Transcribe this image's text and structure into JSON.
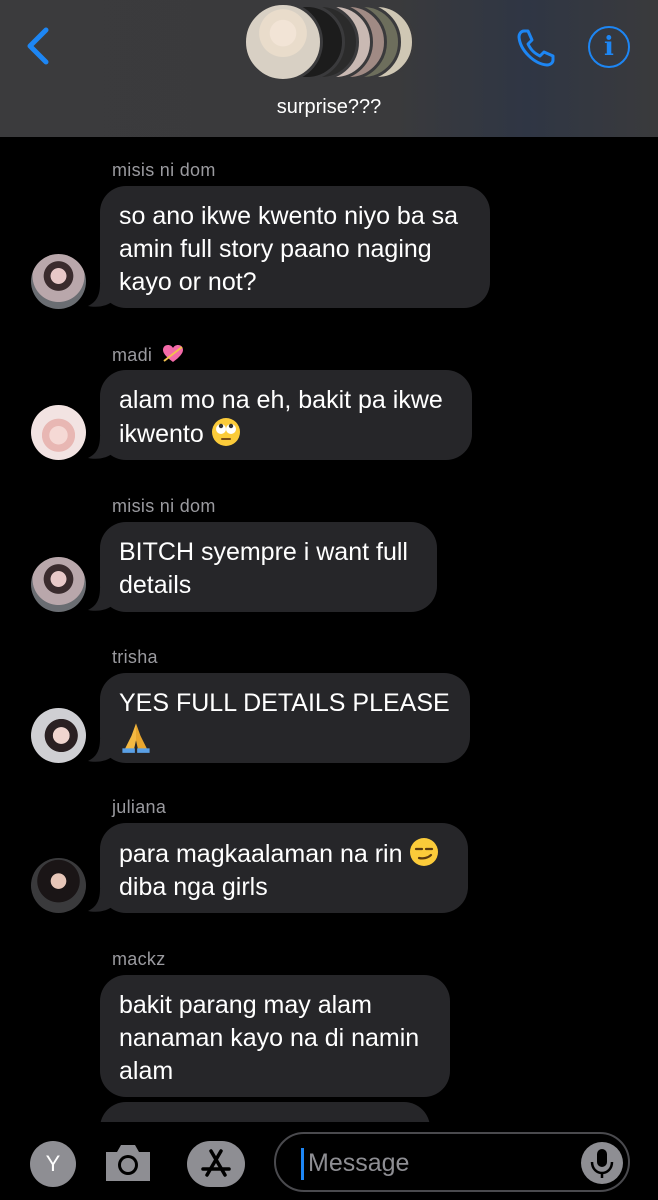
{
  "header": {
    "group_name": "surprise???",
    "accent": "#1d86f4"
  },
  "icons": {
    "back": "chevron-left-icon",
    "call": "phone-icon",
    "info": "info-icon",
    "camera": "camera-icon",
    "app_store": "app-store-icon",
    "mic": "microphone-icon"
  },
  "messages": [
    {
      "sender": "misis ni dom",
      "lines": [
        "so ano ikwe kwento niyo ba sa",
        "amin full story paano naging",
        "kayo or not?"
      ]
    },
    {
      "sender": "madi",
      "sender_emoji": "heart-with-arrow",
      "lines": [
        "alam mo na eh, bakit pa ikwe",
        "ikwento"
      ],
      "line_emoji": "face-with-rolling-eyes"
    },
    {
      "sender": "misis ni dom",
      "lines": [
        "BITCH syempre i want full",
        "details"
      ]
    },
    {
      "sender": "trisha",
      "lines": [
        "YES FULL DETAILS PLEASE"
      ],
      "line_emoji": "folded-hands"
    },
    {
      "sender": "juliana",
      "lines": [
        "para magkaalaman na rin",
        "diba nga girls"
      ],
      "line_emoji": "smirking-face"
    },
    {
      "sender": "mackz",
      "lines": [
        "bakit parang may alam",
        "nanaman kayo na di namin",
        "alam"
      ]
    }
  ],
  "composer": {
    "avatar_letter": "Y",
    "placeholder": "Message"
  }
}
